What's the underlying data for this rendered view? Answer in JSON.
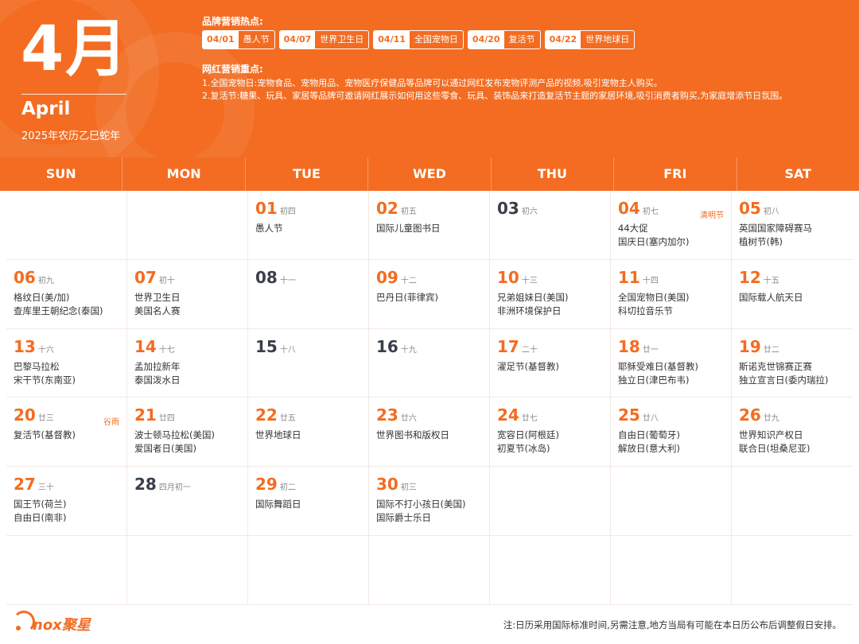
{
  "header": {
    "month": "4月",
    "month_en": "April",
    "lunar_year": "2025年农历乙巳蛇年",
    "hot_title": "品牌营销热点:",
    "hot_tags": [
      {
        "date": "04/01",
        "name": "愚人节"
      },
      {
        "date": "04/07",
        "name": "世界卫生日"
      },
      {
        "date": "04/11",
        "name": "全国宠物日"
      },
      {
        "date": "04/20",
        "name": "复活节"
      },
      {
        "date": "04/22",
        "name": "世界地球日"
      }
    ],
    "key_title": "网红营销重点:",
    "key_points": [
      "1.全国宠物日:宠物食品、宠物用品、宠物医疗保健品等品牌可以通过网红发布宠物评测产品的视频,吸引宠物主人购买。",
      "2.复活节:糖果、玩具、家居等品牌可邀请网红展示如何用这些零食、玩具、装饰品来打造复活节主题的家居环境,吸引消费者购买,为家庭增添节日氛围。"
    ]
  },
  "weekdays": [
    "SUN",
    "MON",
    "TUE",
    "WED",
    "THU",
    "FRI",
    "SAT"
  ],
  "cells": [
    {
      "day": "",
      "lunar": "",
      "solar": "",
      "events": [],
      "style": "orange"
    },
    {
      "day": "",
      "lunar": "",
      "solar": "",
      "events": [],
      "style": "orange"
    },
    {
      "day": "01",
      "lunar": "初四",
      "solar": "",
      "events": [
        "愚人节"
      ],
      "style": "orange"
    },
    {
      "day": "02",
      "lunar": "初五",
      "solar": "",
      "events": [
        "国际儿童图书日"
      ],
      "style": "orange"
    },
    {
      "day": "03",
      "lunar": "初六",
      "solar": "",
      "events": [],
      "style": "dark"
    },
    {
      "day": "04",
      "lunar": "初七",
      "solar": "清明节",
      "events": [
        "44大促",
        "国庆日(塞内加尔)"
      ],
      "style": "orange"
    },
    {
      "day": "05",
      "lunar": "初八",
      "solar": "",
      "events": [
        "英国国家障碍赛马",
        "植树节(韩)"
      ],
      "style": "orange"
    },
    {
      "day": "06",
      "lunar": "初九",
      "solar": "",
      "events": [
        "格纹日(美/加)",
        "查库里王朝纪念(泰国)"
      ],
      "style": "orange"
    },
    {
      "day": "07",
      "lunar": "初十",
      "solar": "",
      "events": [
        "世界卫生日",
        "美国名人赛"
      ],
      "style": "orange"
    },
    {
      "day": "08",
      "lunar": "十一",
      "solar": "",
      "events": [],
      "style": "dark"
    },
    {
      "day": "09",
      "lunar": "十二",
      "solar": "",
      "events": [
        "巴丹日(菲律宾)"
      ],
      "style": "orange"
    },
    {
      "day": "10",
      "lunar": "十三",
      "solar": "",
      "events": [
        "兄弟姐妹日(美国)",
        "非洲环境保护日"
      ],
      "style": "orange"
    },
    {
      "day": "11",
      "lunar": "十四",
      "solar": "",
      "events": [
        "全国宠物日(美国)",
        "科切拉音乐节"
      ],
      "style": "orange"
    },
    {
      "day": "12",
      "lunar": "十五",
      "solar": "",
      "events": [
        "国际载人航天日"
      ],
      "style": "orange"
    },
    {
      "day": "13",
      "lunar": "十六",
      "solar": "",
      "events": [
        "巴黎马拉松",
        "宋干节(东南亚)"
      ],
      "style": "orange"
    },
    {
      "day": "14",
      "lunar": "十七",
      "solar": "",
      "events": [
        "孟加拉新年",
        "泰国泼水日"
      ],
      "style": "orange"
    },
    {
      "day": "15",
      "lunar": "十八",
      "solar": "",
      "events": [],
      "style": "dark"
    },
    {
      "day": "16",
      "lunar": "十九",
      "solar": "",
      "events": [],
      "style": "dark"
    },
    {
      "day": "17",
      "lunar": "二十",
      "solar": "",
      "events": [
        "濯足节(基督教)"
      ],
      "style": "orange"
    },
    {
      "day": "18",
      "lunar": "廿一",
      "solar": "",
      "events": [
        "耶稣受难日(基督教)",
        "独立日(津巴布韦)"
      ],
      "style": "orange"
    },
    {
      "day": "19",
      "lunar": "廿二",
      "solar": "",
      "events": [
        "斯诺克世锦赛正赛",
        "独立宣言日(委内瑞拉)"
      ],
      "style": "orange"
    },
    {
      "day": "20",
      "lunar": "廿三",
      "solar": "谷雨",
      "events": [
        "复活节(基督教)"
      ],
      "style": "orange"
    },
    {
      "day": "21",
      "lunar": "廿四",
      "solar": "",
      "events": [
        "波士顿马拉松(美国)",
        "爱国者日(美国)"
      ],
      "style": "orange"
    },
    {
      "day": "22",
      "lunar": "廿五",
      "solar": "",
      "events": [
        "世界地球日"
      ],
      "style": "orange"
    },
    {
      "day": "23",
      "lunar": "廿六",
      "solar": "",
      "events": [
        "世界图书和版权日"
      ],
      "style": "orange"
    },
    {
      "day": "24",
      "lunar": "廿七",
      "solar": "",
      "events": [
        "宽容日(阿根廷)",
        "初夏节(冰岛)"
      ],
      "style": "orange"
    },
    {
      "day": "25",
      "lunar": "廿八",
      "solar": "",
      "events": [
        "自由日(葡萄牙)",
        "解放日(意大利)"
      ],
      "style": "orange"
    },
    {
      "day": "26",
      "lunar": "廿九",
      "solar": "",
      "events": [
        "世界知识产权日",
        "联合日(坦桑尼亚)"
      ],
      "style": "orange"
    },
    {
      "day": "27",
      "lunar": "三十",
      "solar": "",
      "events": [
        "国王节(荷兰)",
        "自由日(南非)"
      ],
      "style": "orange"
    },
    {
      "day": "28",
      "lunar": "四月初一",
      "solar": "",
      "events": [],
      "style": "dark"
    },
    {
      "day": "29",
      "lunar": "初二",
      "solar": "",
      "events": [
        "国际舞蹈日"
      ],
      "style": "orange"
    },
    {
      "day": "30",
      "lunar": "初三",
      "solar": "",
      "events": [
        "国际不打小孩日(美国)",
        "国际爵士乐日"
      ],
      "style": "orange"
    },
    {
      "day": "",
      "lunar": "",
      "solar": "",
      "events": [],
      "style": "orange"
    },
    {
      "day": "",
      "lunar": "",
      "solar": "",
      "events": [],
      "style": "orange"
    },
    {
      "day": "",
      "lunar": "",
      "solar": "",
      "events": [],
      "style": "orange"
    },
    {
      "day": "",
      "lunar": "",
      "solar": "",
      "events": [],
      "style": "orange"
    },
    {
      "day": "",
      "lunar": "",
      "solar": "",
      "events": [],
      "style": "orange"
    },
    {
      "day": "",
      "lunar": "",
      "solar": "",
      "events": [],
      "style": "orange"
    },
    {
      "day": "",
      "lunar": "",
      "solar": "",
      "events": [],
      "style": "orange"
    },
    {
      "day": "",
      "lunar": "",
      "solar": "",
      "events": [],
      "style": "orange"
    },
    {
      "day": "",
      "lunar": "",
      "solar": "",
      "events": [],
      "style": "orange"
    },
    {
      "day": "",
      "lunar": "",
      "solar": "",
      "events": [],
      "style": "orange"
    }
  ],
  "footer": {
    "logo_text": "nox聚星",
    "note": "注:日历采用国际标准时间,另需注意,地方当局有可能在本日历公布后调整假日安排。"
  },
  "colors": {
    "brand": "#f36c21",
    "dark_day": "#3a3f4a"
  }
}
